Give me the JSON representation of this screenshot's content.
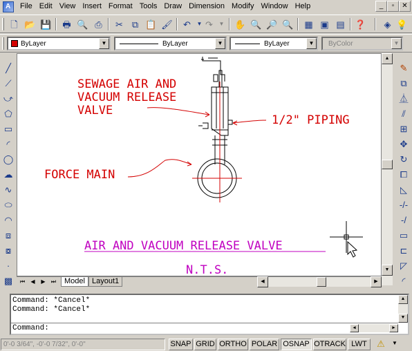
{
  "menu": {
    "items": [
      "File",
      "Edit",
      "View",
      "Insert",
      "Format",
      "Tools",
      "Draw",
      "Dimension",
      "Modify",
      "Window",
      "Help"
    ]
  },
  "window_controls": {
    "minimize": "_",
    "restore": "▫",
    "close": "✕"
  },
  "properties": {
    "color": "ByLayer",
    "linetype": "ByLayer",
    "lineweight": "ByLayer",
    "plotstyle": "ByColor"
  },
  "drawing": {
    "labels": {
      "valve_line1": "SEWAGE AIR AND",
      "valve_line2": "VACUUM RELEASE",
      "valve_line3": "VALVE",
      "piping": "1/2\" PIPING",
      "force_main": "FORCE MAIN",
      "title": "AIR AND VACUUM RELEASE VALVE",
      "scale": "N.T.S."
    },
    "colors": {
      "annotation": "#d40000",
      "title": "#c000c0",
      "object": "#000000",
      "background": "#ffffff"
    }
  },
  "layout_tabs": {
    "model": "Model",
    "layout1": "Layout1"
  },
  "command": {
    "history": [
      "Command: *Cancel*",
      "Command: *Cancel*"
    ],
    "prompt": "Command:"
  },
  "status": {
    "coordinates": "0'-0 3/64\", -0'-0 7/32\", 0'-0\"",
    "toggles": [
      "SNAP",
      "GRID",
      "ORTHO",
      "POLAR",
      "OSNAP",
      "OTRACK",
      "LWT"
    ],
    "active": [
      "OSNAP"
    ]
  }
}
